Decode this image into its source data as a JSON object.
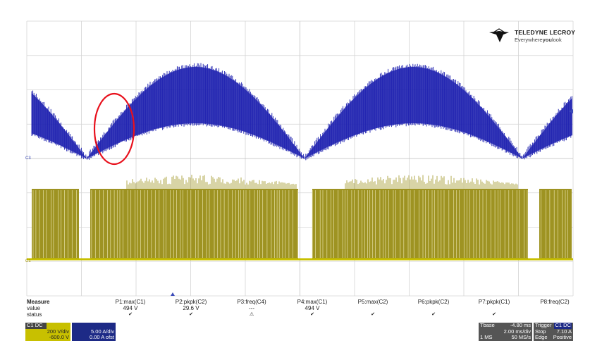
{
  "brand": {
    "name": "TELEDYNE LECROY",
    "tagline_prefix": "Everywhere",
    "tagline_bold": "you",
    "tagline_suffix": "look",
    "logo_icon": "lecroy-bird-logo"
  },
  "markers": {
    "c3_label": "C3",
    "c1_label": "C1"
  },
  "measure": {
    "header": "Measure",
    "value_label": "value",
    "status_label": "status",
    "params": [
      {
        "name": "P1:max(C1)",
        "value": "494 V",
        "status": "check"
      },
      {
        "name": "P2:pkpk(C2)",
        "value": "29.6 V",
        "status": "check"
      },
      {
        "name": "P3:freq(C4)",
        "value": "---",
        "status": "warning"
      },
      {
        "name": "P4:max(C1)",
        "value": "494 V",
        "status": "check"
      },
      {
        "name": "P5:max(C2)",
        "value": "",
        "status": "check"
      },
      {
        "name": "P6:pkpk(C2)",
        "value": "",
        "status": "check"
      },
      {
        "name": "P7:pkpk(C1)",
        "value": "",
        "status": "check"
      },
      {
        "name": "P8:freq(C2)",
        "value": "",
        "status": ""
      }
    ]
  },
  "channels": [
    {
      "id": "C1",
      "coupling": "DC",
      "vdiv": "200 V/div",
      "offset": "-600.0 V",
      "color": "#c8c000"
    },
    {
      "id": "C3",
      "coupling": "",
      "vdiv": "5.00 A/div",
      "offset": "0.00 A ofst",
      "color": "#3a4ab8"
    }
  ],
  "timebase": {
    "label": "Tbase",
    "delay": "-4.80 ms",
    "tdiv": "2.00 ms/div",
    "samples": "1 MS",
    "rate": "50 MS/s"
  },
  "trigger": {
    "label": "Trigger",
    "source": "C1 DC",
    "mode": "Stop",
    "level": "7.10 A",
    "type": "Edge",
    "slope": "Positive"
  },
  "colors": {
    "current_trace": "#1f22b0",
    "voltage_trace": "#9e9322",
    "highlight": "#e8101c",
    "grid": "#d4d4d4"
  }
}
